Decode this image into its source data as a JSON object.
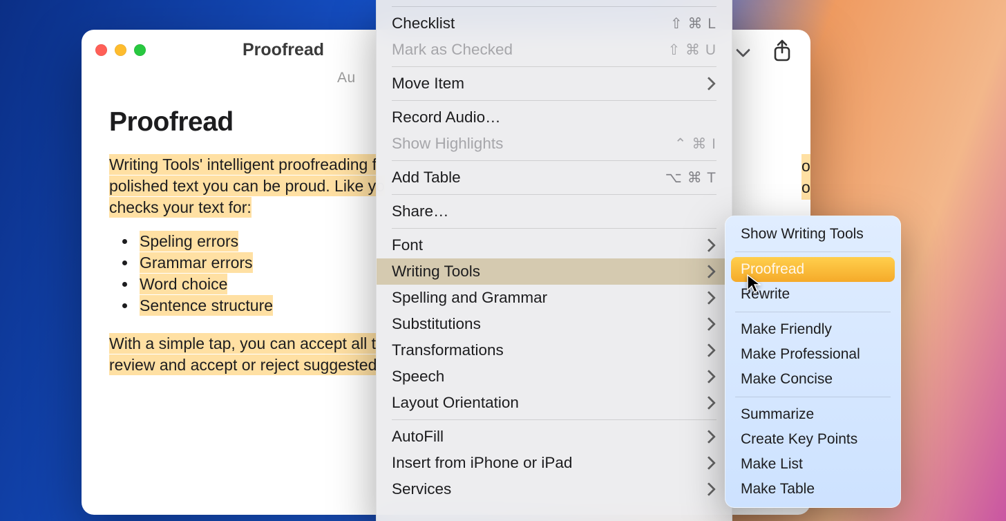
{
  "window": {
    "title": "Proofread",
    "subtitle_fragment": "Au"
  },
  "note": {
    "heading": "Proofread",
    "para1_a": "Writing Tools' intelligent proofreading f",
    "para1_b": "polished text you can be proud. Like yo",
    "para1_c": "checks your text for:",
    "bullets": [
      "Speling errors",
      "Grammar errors",
      "Word choice",
      "Sentence structure"
    ],
    "para2_a": "With a simple tap, you can accept all t",
    "para2_b": "review and accept or reject suggested",
    "frag_right_1": "o",
    "frag_right_2": "ol"
  },
  "menu": {
    "checklist": {
      "label": "Checklist",
      "shortcut": "⇧ ⌘ L"
    },
    "mark_checked": {
      "label": "Mark as Checked",
      "shortcut": "⇧ ⌘ U"
    },
    "move_item": {
      "label": "Move Item"
    },
    "record_audio": {
      "label": "Record Audio…"
    },
    "show_highlights": {
      "label": "Show Highlights",
      "shortcut": "⌃ ⌘ I"
    },
    "add_table": {
      "label": "Add Table",
      "shortcut": "⌥ ⌘ T"
    },
    "share": {
      "label": "Share…"
    },
    "font": {
      "label": "Font"
    },
    "writing_tools": {
      "label": "Writing Tools"
    },
    "spelling_grammar": {
      "label": "Spelling and Grammar"
    },
    "substitutions": {
      "label": "Substitutions"
    },
    "transformations": {
      "label": "Transformations"
    },
    "speech": {
      "label": "Speech"
    },
    "layout": {
      "label": "Layout Orientation"
    },
    "autofill": {
      "label": "AutoFill"
    },
    "insert_from": {
      "label": "Insert from iPhone or iPad"
    },
    "services": {
      "label": "Services"
    }
  },
  "submenu": {
    "show_wt": "Show Writing Tools",
    "proofread": "Proofread",
    "rewrite": "Rewrite",
    "make_friendly": "Make Friendly",
    "make_professional": "Make Professional",
    "make_concise": "Make Concise",
    "summarize": "Summarize",
    "create_keypoints": "Create Key Points",
    "make_list": "Make List",
    "make_table": "Make Table"
  }
}
